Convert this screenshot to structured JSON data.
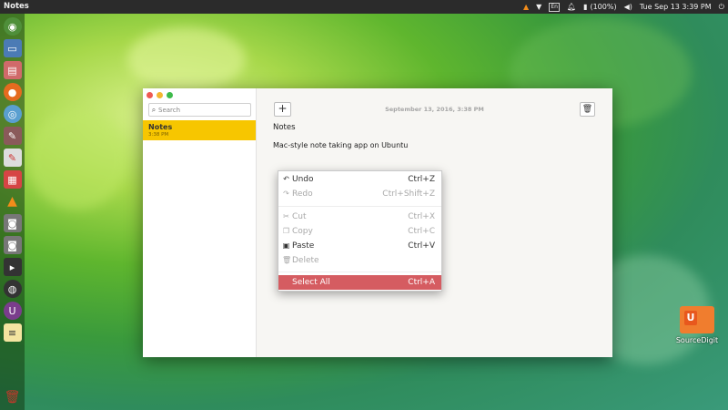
{
  "panel": {
    "app_title": "Notes",
    "battery": "(100%)",
    "datetime": "Tue Sep 13  3:39 PM",
    "keyboard": "En"
  },
  "desktop": {
    "icon_label": "SourceDigit",
    "icon_glyph": "U"
  },
  "window": {
    "search_placeholder": "Search",
    "note_list": [
      {
        "title": "Notes",
        "time": "3:38 PM"
      }
    ],
    "add_label": "+",
    "date": "September 13, 2016, 3:38 PM",
    "note_title": "Notes",
    "note_body": "Mac-style note taking app on Ubuntu"
  },
  "context_menu": {
    "items": [
      {
        "icon": "undo-icon",
        "label": "Undo",
        "shortcut": "Ctrl+Z",
        "enabled": true
      },
      {
        "icon": "redo-icon",
        "label": "Redo",
        "shortcut": "Ctrl+Shift+Z",
        "enabled": false
      },
      {
        "icon": "cut-icon",
        "label": "Cut",
        "shortcut": "Ctrl+X",
        "enabled": false
      },
      {
        "icon": "copy-icon",
        "label": "Copy",
        "shortcut": "Ctrl+C",
        "enabled": false
      },
      {
        "icon": "paste-icon",
        "label": "Paste",
        "shortcut": "Ctrl+V",
        "enabled": true
      },
      {
        "icon": "delete-icon",
        "label": "Delete",
        "shortcut": "",
        "enabled": false
      },
      {
        "icon": "",
        "label": "Select All",
        "shortcut": "Ctrl+A",
        "enabled": true,
        "highlighted": true
      }
    ],
    "highlight_color": "#d55c61"
  },
  "colors": {
    "note_selected": "#f7c600",
    "panel_bg": "#2b2b2b"
  }
}
